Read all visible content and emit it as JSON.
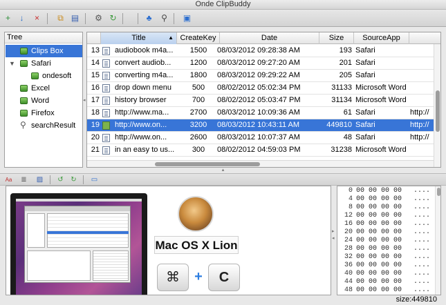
{
  "window": {
    "title": "Onde ClipBuddy"
  },
  "toolbar": {
    "buttons": [
      {
        "name": "new-clip-button",
        "icon": "add-doc-icon",
        "glyph": "+",
        "color": "#2f8f3a"
      },
      {
        "name": "import-button",
        "icon": "import-icon",
        "glyph": "↓",
        "color": "#2a6fc9"
      },
      {
        "name": "delete-button",
        "icon": "delete-doc-icon",
        "glyph": "×",
        "color": "#c93030"
      },
      {
        "name": "copy-button",
        "icon": "copy-icon",
        "glyph": "⧉",
        "color": "#c98a1a"
      },
      {
        "name": "paste-button",
        "icon": "paste-icon",
        "glyph": "▤",
        "color": "#3a62b0"
      },
      {
        "name": "settings-button",
        "icon": "gear-icon",
        "glyph": "⚙",
        "color": "#555555"
      },
      {
        "name": "refresh-button",
        "icon": "refresh-icon",
        "glyph": "↻",
        "color": "#3c9a3c"
      },
      {
        "name": "tree-button",
        "icon": "tree-icon",
        "glyph": "♣",
        "color": "#2d6fcf"
      },
      {
        "name": "search-button",
        "icon": "search-icon",
        "glyph": "⚲",
        "color": "#444444"
      },
      {
        "name": "window-button",
        "icon": "window-icon",
        "glyph": "▣",
        "color": "#2d6fcf"
      }
    ]
  },
  "tree": {
    "header": "Tree",
    "items": [
      {
        "label": "Clips Box",
        "icon": "tree-node-icon",
        "selected": true
      },
      {
        "label": "Safari",
        "icon": "tree-node-icon",
        "expanded": true
      },
      {
        "label": "ondesoft",
        "icon": "tree-node-icon"
      },
      {
        "label": "Excel",
        "icon": "tree-node-icon"
      },
      {
        "label": "Word",
        "icon": "tree-node-icon"
      },
      {
        "label": "Firefox",
        "icon": "tree-node-icon"
      },
      {
        "label": "searchResult",
        "icon": "search-icon"
      }
    ]
  },
  "table": {
    "columns": [
      "Title",
      "CreateKey",
      "Date",
      "Size",
      "SourceApp"
    ],
    "sorted_column": "Title",
    "rows": [
      {
        "num": "13",
        "title": "audiobook m4a...",
        "key": "1500",
        "date": "08/03/2012 09:28:38 AM",
        "size": "193",
        "app": "Safari",
        "extra": ""
      },
      {
        "num": "14",
        "title": "convert audiob...",
        "key": "1200",
        "date": "08/03/2012 09:27:20 AM",
        "size": "201",
        "app": "Safari",
        "extra": ""
      },
      {
        "num": "15",
        "title": "converting m4a...",
        "key": "1800",
        "date": "08/03/2012 09:29:22 AM",
        "size": "205",
        "app": "Safari",
        "extra": ""
      },
      {
        "num": "16",
        "title": "drop down menu",
        "key": "500",
        "date": "08/02/2012 05:02:34 PM",
        "size": "31133",
        "app": "Microsoft Word",
        "extra": ""
      },
      {
        "num": "17",
        "title": "history browser",
        "key": "700",
        "date": "08/02/2012 05:03:47 PM",
        "size": "31134",
        "app": "Microsoft Word",
        "extra": ""
      },
      {
        "num": "18",
        "title": "http://www.ma...",
        "key": "2700",
        "date": "08/03/2012 10:09:36 AM",
        "size": "61",
        "app": "Safari",
        "extra": "http://"
      },
      {
        "num": "19",
        "title": "http://www.on...",
        "key": "3200",
        "date": "08/03/2012 10:43:11 AM",
        "size": "449810",
        "app": "Safari",
        "extra": "http://",
        "selected": true,
        "image": true
      },
      {
        "num": "20",
        "title": "http://www.on...",
        "key": "2600",
        "date": "08/03/2012 10:07:37 AM",
        "size": "48",
        "app": "Safari",
        "extra": "http://"
      },
      {
        "num": "21",
        "title": "in an easy to us...",
        "key": "300",
        "date": "08/02/2012 04:59:03 PM",
        "size": "31238",
        "app": "Microsoft Word",
        "extra": ""
      }
    ]
  },
  "toolbar2": {
    "buttons": [
      {
        "name": "text-view-button",
        "icon": "text-icon",
        "glyph": "Aa",
        "color": "#c03030"
      },
      {
        "name": "rich-view-button",
        "icon": "rich-text-icon",
        "glyph": "≣",
        "color": "#555555"
      },
      {
        "name": "image-view-button",
        "icon": "image-icon",
        "glyph": "▨",
        "color": "#3a62b0"
      },
      {
        "name": "rotate-left-button",
        "icon": "rotate-left-icon",
        "glyph": "↺",
        "color": "#3c9a3c"
      },
      {
        "name": "rotate-right-button",
        "icon": "rotate-right-icon",
        "glyph": "↻",
        "color": "#3c9a3c"
      },
      {
        "name": "monitor-button",
        "icon": "monitor-icon",
        "glyph": "▭",
        "color": "#2d6fcf"
      }
    ]
  },
  "preview": {
    "heading": "Mac OS X Lion",
    "key1": "⌘",
    "plus": "+",
    "key2": "C"
  },
  "hex": {
    "rows": [
      {
        "offset": "0",
        "bytes": "00 00 00 00",
        "ascii": "...."
      },
      {
        "offset": "4",
        "bytes": "00 00 00 00",
        "ascii": "...."
      },
      {
        "offset": "8",
        "bytes": "00 00 00 00",
        "ascii": "...."
      },
      {
        "offset": "12",
        "bytes": "00 00 00 00",
        "ascii": "...."
      },
      {
        "offset": "16",
        "bytes": "00 00 00 00",
        "ascii": "...."
      },
      {
        "offset": "20",
        "bytes": "00 00 00 00",
        "ascii": "...."
      },
      {
        "offset": "24",
        "bytes": "00 00 00 00",
        "ascii": "...."
      },
      {
        "offset": "28",
        "bytes": "00 00 00 00",
        "ascii": "...."
      },
      {
        "offset": "32",
        "bytes": "00 00 00 00",
        "ascii": "...."
      },
      {
        "offset": "36",
        "bytes": "00 00 00 00",
        "ascii": "...."
      },
      {
        "offset": "40",
        "bytes": "00 00 00 00",
        "ascii": "...."
      },
      {
        "offset": "44",
        "bytes": "00 00 00 00",
        "ascii": "...."
      },
      {
        "offset": "48",
        "bytes": "00 00 00 00",
        "ascii": "...."
      }
    ]
  },
  "status": {
    "size_text": "size:449810"
  },
  "colors": {
    "selection": "#3875d7",
    "accent": "#2d7de0"
  }
}
